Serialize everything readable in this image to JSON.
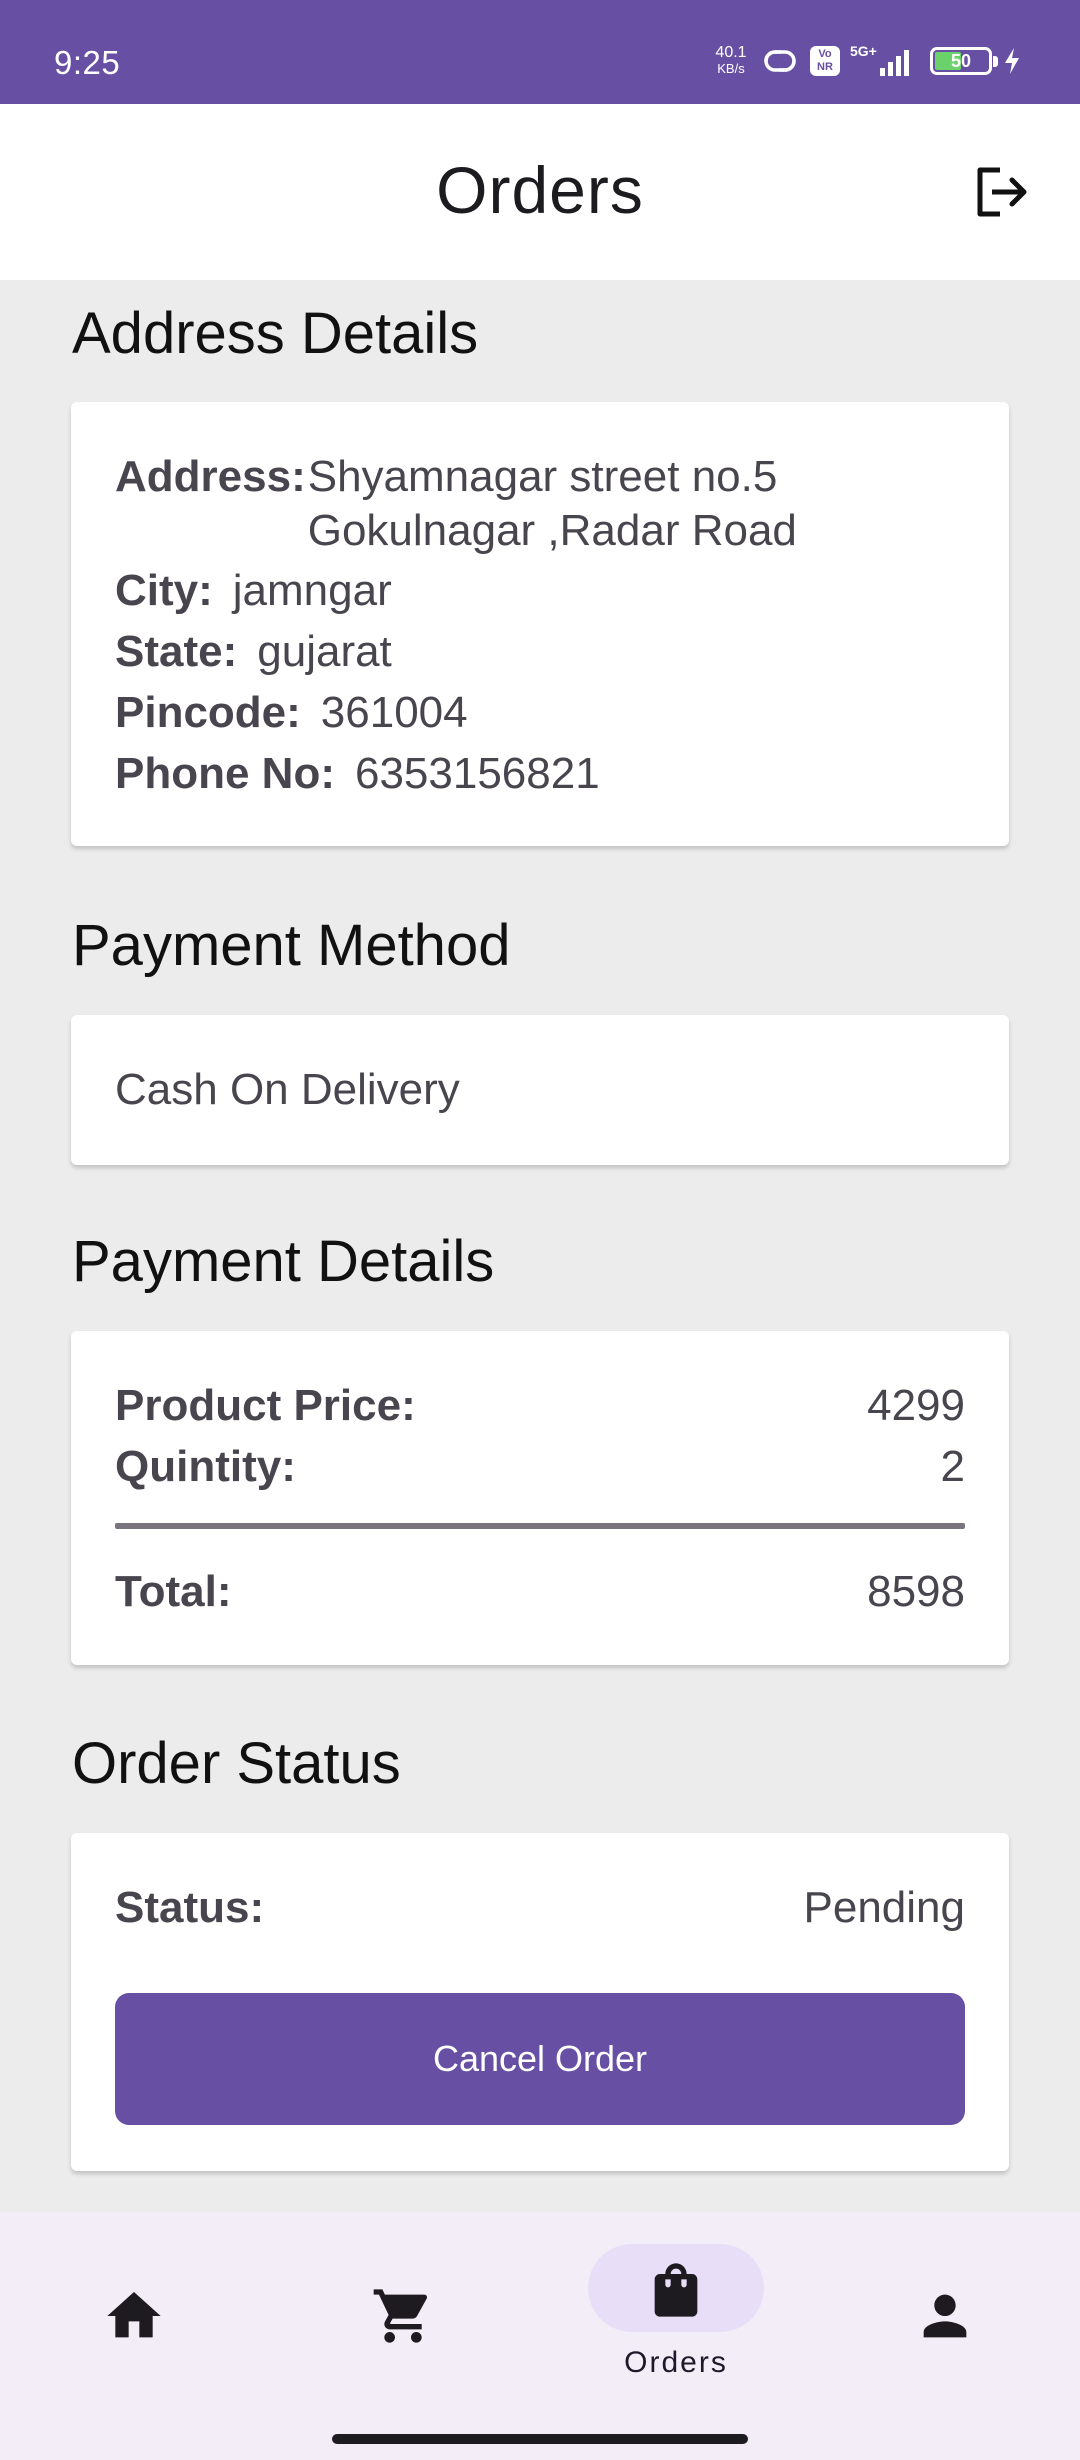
{
  "status_bar": {
    "time": "9:25",
    "net_speed": "40.1",
    "net_unit": "KB/s",
    "volte": "Vo NR",
    "network": "5G+",
    "battery": "50"
  },
  "header": {
    "title": "Orders",
    "logout_icon": "logout-icon"
  },
  "address": {
    "section_title": "Address Details",
    "address_label": "Address:",
    "address_line1": "Shyamnagar street no.5",
    "address_line2": "Gokulnagar ,Radar Road",
    "city_label": "City:",
    "city": "jamngar",
    "state_label": "State:",
    "state": "gujarat",
    "pincode_label": "Pincode:",
    "pincode": "361004",
    "phone_label": "Phone No:",
    "phone": "6353156821"
  },
  "payment_method": {
    "section_title": "Payment Method",
    "value": "Cash On Delivery"
  },
  "payment_details": {
    "section_title": "Payment Details",
    "price_label": "Product Price:",
    "price": "4299",
    "qty_label": "Quintity:",
    "qty": "2",
    "total_label": "Total:",
    "total": "8598"
  },
  "order_status": {
    "section_title": "Order Status",
    "status_label": "Status:",
    "status": "Pending",
    "cancel_label": "Cancel Order"
  },
  "bottom_nav": {
    "items": [
      {
        "icon": "home-icon"
      },
      {
        "icon": "cart-icon"
      },
      {
        "icon": "shopping-bag-icon",
        "label": "Orders",
        "active": true
      },
      {
        "icon": "person-icon"
      }
    ]
  },
  "colors": {
    "primary": "#6750a4",
    "nav_pill": "#e8def8",
    "nav_bg": "#f3edf7",
    "battery_fill": "#6bd16b"
  }
}
